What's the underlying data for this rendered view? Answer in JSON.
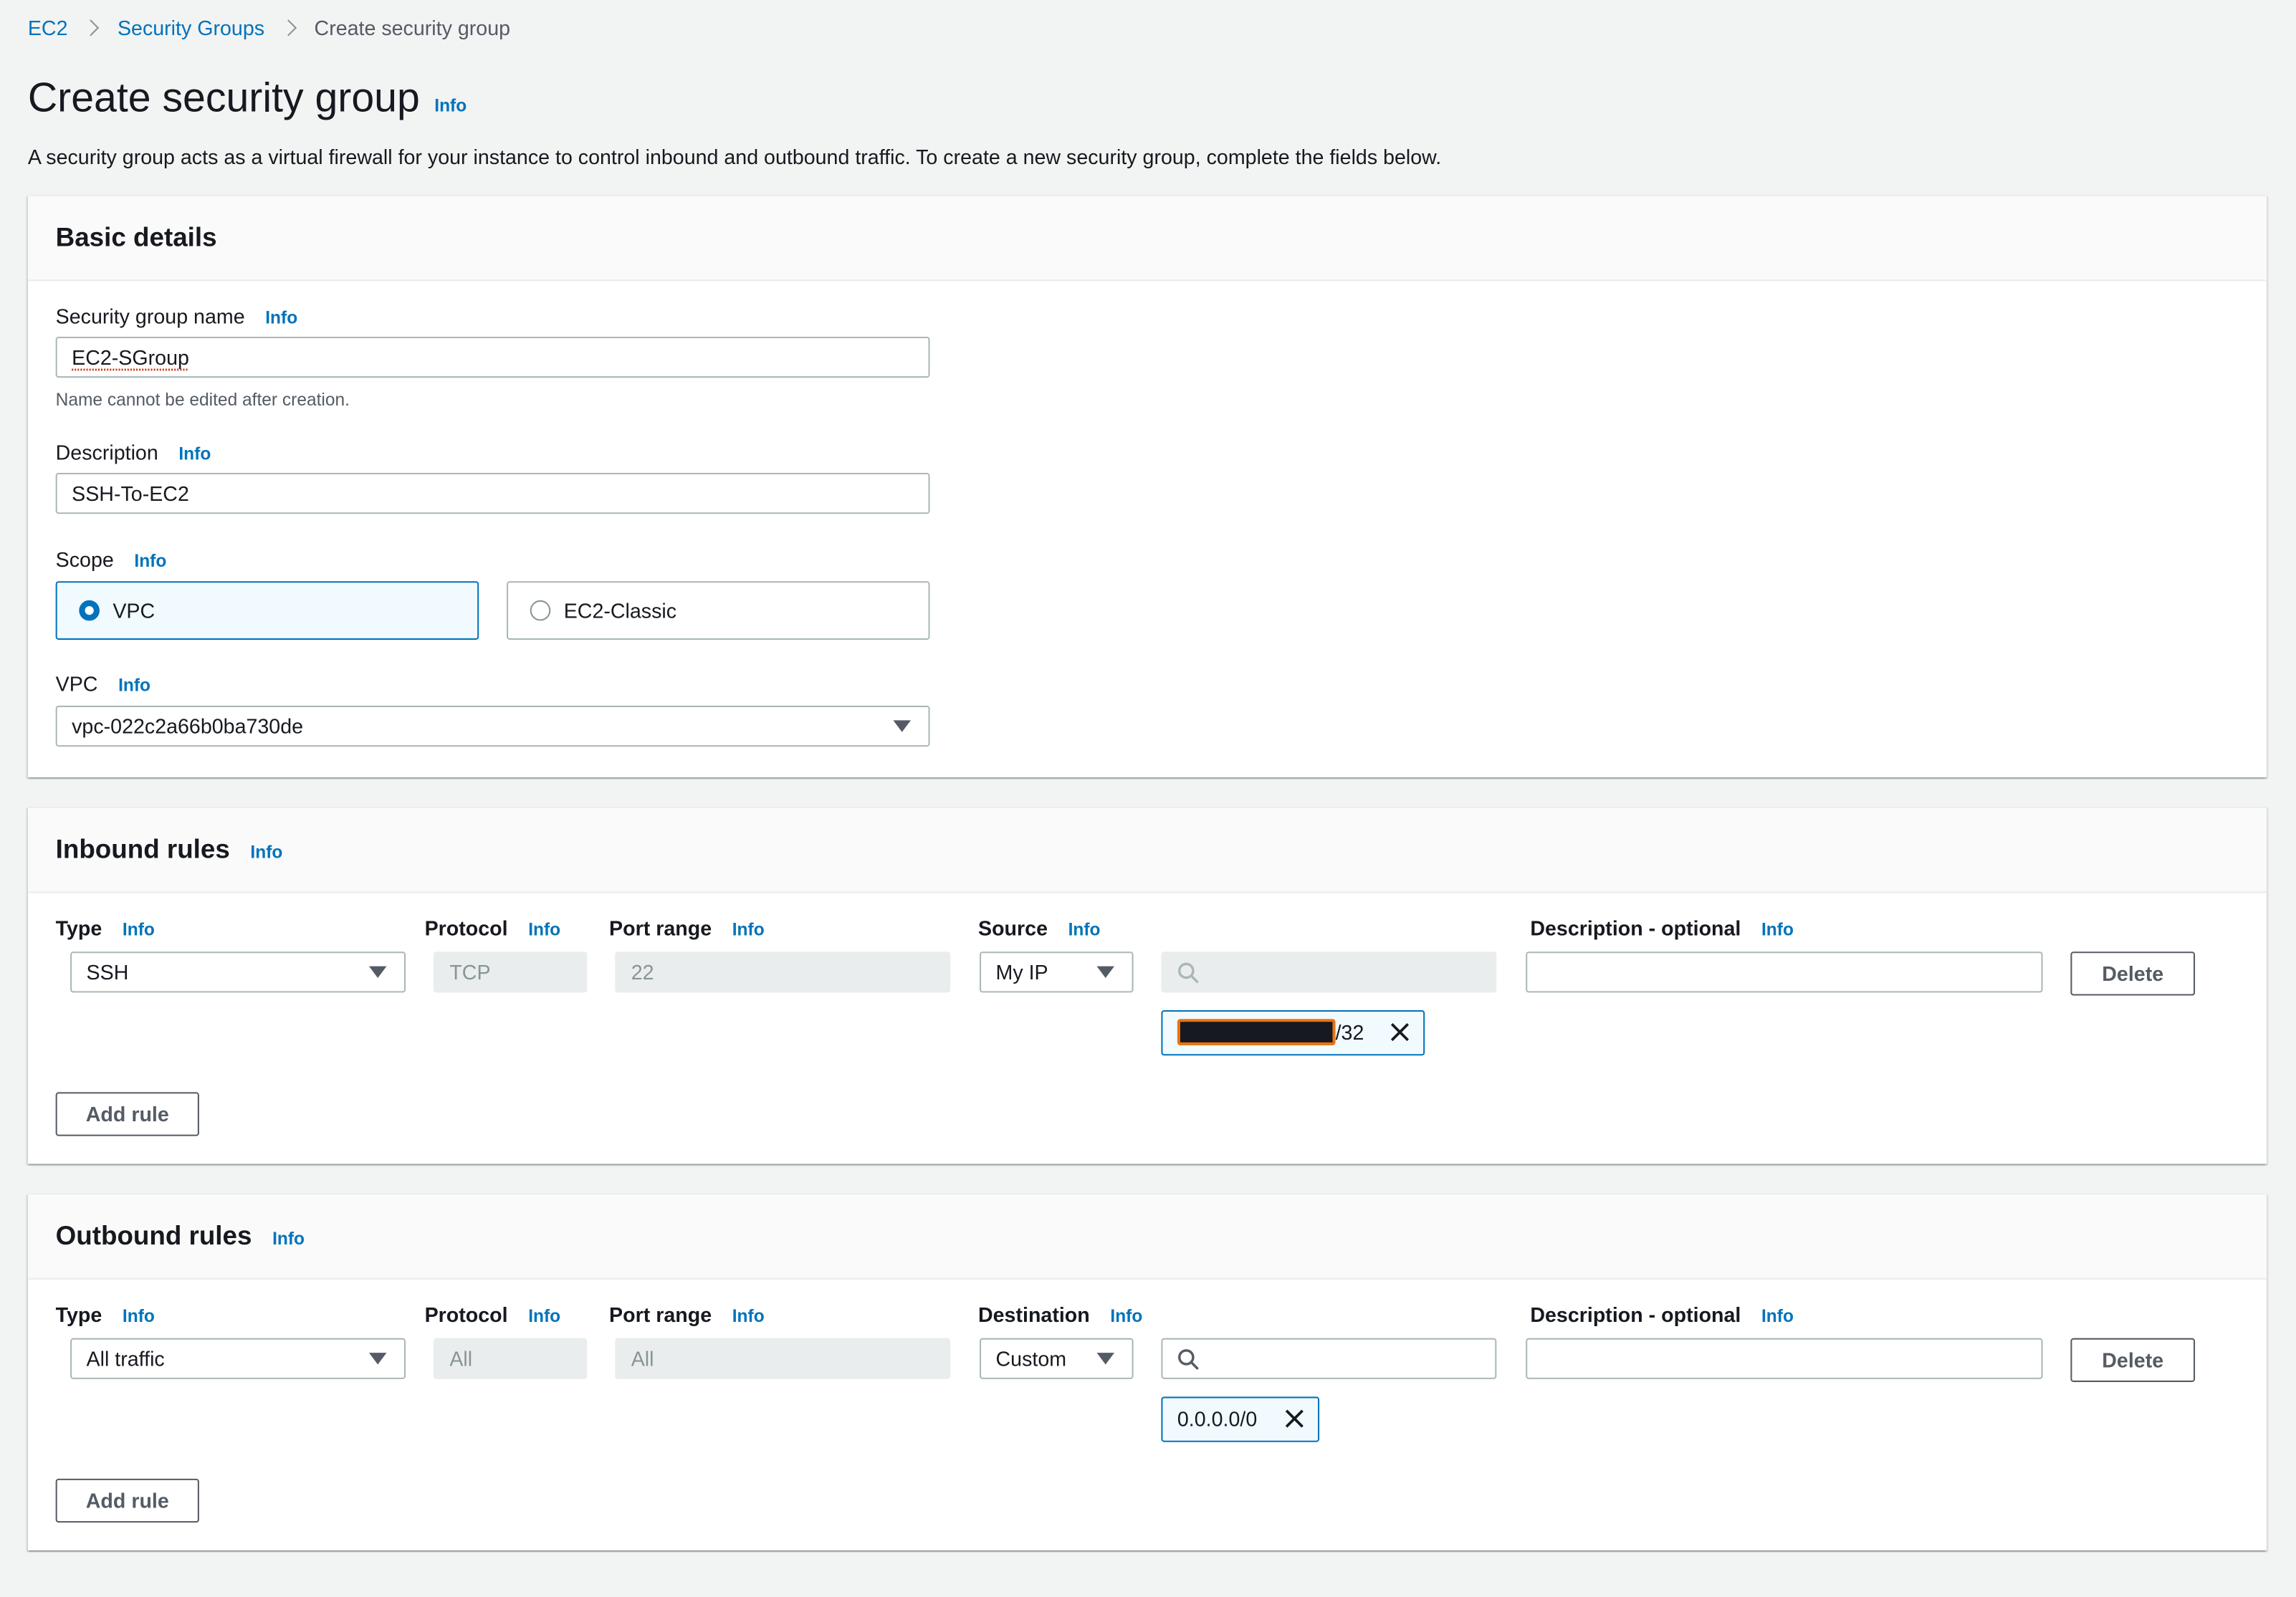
{
  "breadcrumb": [
    "EC2",
    "Security Groups",
    "Create security group"
  ],
  "page": {
    "title": "Create security group",
    "info": "Info",
    "description": "A security group acts as a virtual firewall for your instance to control inbound and outbound traffic. To create a new security group, complete the fields below."
  },
  "basic": {
    "title": "Basic details",
    "name_label": "Security group name",
    "name_value": "EC2-SGroup",
    "name_hint": "Name cannot be edited after creation.",
    "desc_label": "Description",
    "desc_value": "SSH-To-EC2",
    "scope_label": "Scope",
    "scope_options": [
      "VPC",
      "EC2-Classic"
    ],
    "scope_selected": "VPC",
    "vpc_label": "VPC",
    "vpc_value": "vpc-022c2a66b0ba730de"
  },
  "inbound": {
    "title": "Inbound rules",
    "headers": {
      "type": "Type",
      "protocol": "Protocol",
      "port": "Port range",
      "source": "Source",
      "desc": "Description - optional"
    },
    "rule": {
      "type": "SSH",
      "protocol": "TCP",
      "port": "22",
      "source": "My IP",
      "search_value": "",
      "token_suffix": "/32",
      "description": ""
    },
    "delete": "Delete",
    "add": "Add rule"
  },
  "outbound": {
    "title": "Outbound rules",
    "headers": {
      "type": "Type",
      "protocol": "Protocol",
      "port": "Port range",
      "destination": "Destination",
      "desc": "Description - optional"
    },
    "rule": {
      "type": "All traffic",
      "protocol": "All",
      "port": "All",
      "destination": "Custom",
      "search_value": "",
      "token": "0.0.0.0/0",
      "description": ""
    },
    "delete": "Delete",
    "add": "Add rule"
  },
  "colors": {
    "link": "#0073bb",
    "background": "#f2f3f3",
    "selected_tile": "#f1faff"
  },
  "icons": [
    "chevron-right-icon",
    "caret-down-icon",
    "search-icon",
    "close-icon",
    "radio-icon"
  ]
}
